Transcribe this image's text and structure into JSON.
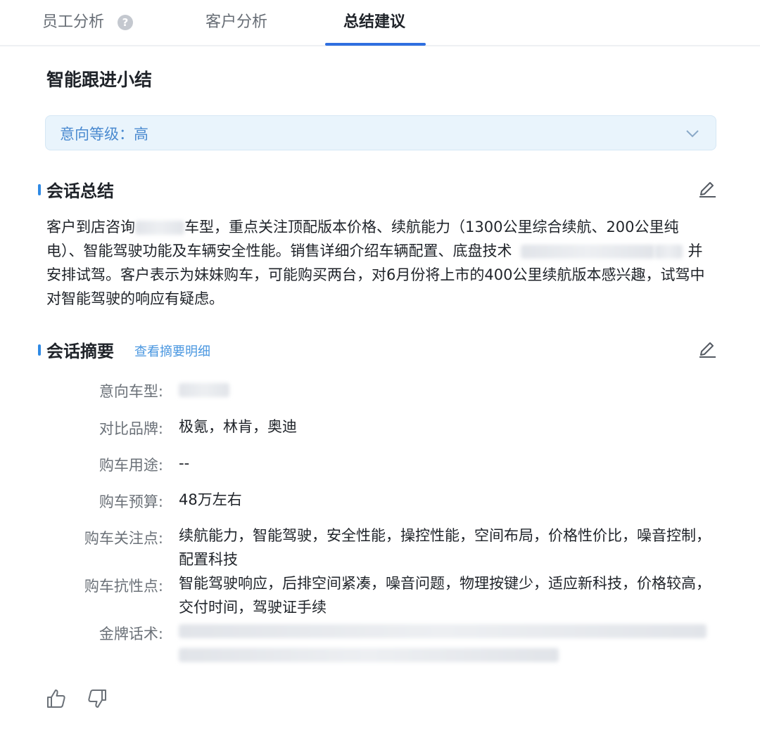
{
  "tabs": [
    {
      "label": "员工分析"
    },
    {
      "label": "客户分析"
    },
    {
      "label": "总结建议"
    }
  ],
  "active_tab": "总结建议",
  "page_title": "智能跟进小结",
  "intent_level": "意向等级：高",
  "conversation_summary": {
    "title": "会话总结",
    "text_part1": "客户到店咨询",
    "text_part2": "车型，重点关注顶配版本价格、续航能力（1300公里综合续航、200公里纯电）、智能驾驶功能及车辆安全性能。销售详细介绍车辆配置、底盘技术",
    "text_part3": "并安排试驾。客户表示为妹妹购车，可能购买两台，对6月份将上市的400公里续航版本感兴趣，试驾中对智能驾驶的响应有疑虑。"
  },
  "conversation_digest": {
    "title": "会话摘要",
    "detail_link": "查看摘要明细",
    "fields": [
      {
        "label": "意向车型:",
        "value": ""
      },
      {
        "label": "对比品牌:",
        "value": "极氪，林肯，奥迪"
      },
      {
        "label": "购车用途:",
        "value": "--"
      },
      {
        "label": "购车预算:",
        "value": "48万左右"
      },
      {
        "label": "购车关注点:",
        "value": "续航能力，智能驾驶，安全性能，操控性能，空间布局，价格性价比，噪音控制，配置科技"
      },
      {
        "label": "购车抗性点:",
        "value": "智能驾驶响应，后排空间紧凑，噪音问题，物理按键少，适应新科技，价格较高，交付时间，驾驶证手续"
      },
      {
        "label": "金牌话术:",
        "value": ""
      }
    ]
  },
  "colors": {
    "accent": "#2f6fe0",
    "link": "#4a97e0",
    "intent_bg": "#e9f4fc"
  },
  "icons": [
    "help-icon",
    "chevron-down-icon",
    "edit-icon",
    "thumbs-up-icon",
    "thumbs-down-icon"
  ]
}
